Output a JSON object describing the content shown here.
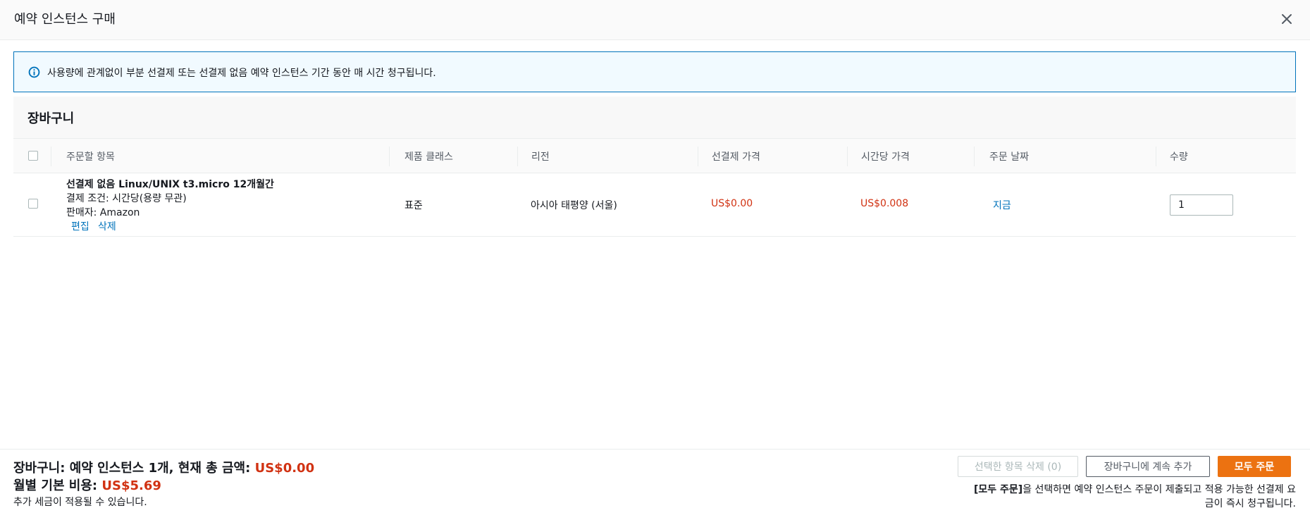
{
  "modal": {
    "title": "예약 인스턴스 구매"
  },
  "alert": {
    "text": "사용량에 관계없이 부분 선결제 또는 선결제 없음 예약 인스턴스 기간 동안 매 시간 청구됩니다."
  },
  "cart": {
    "title": "장바구니",
    "columns": [
      "주문할 항목",
      "제품 클래스",
      "리전",
      "선결제 가격",
      "시간당 가격",
      "주문 날짜",
      "수량"
    ],
    "rows": [
      {
        "title": "선결제 없음 Linux/UNIX t3.micro 12개월간",
        "payment_terms": "결제 조건: 시간당(용량 무관)",
        "seller": "판매자: Amazon",
        "edit_label": "편집",
        "delete_label": "삭제",
        "product_class": "표준",
        "region": "아시아 태평양 (서울)",
        "upfront_price": "US$0.00",
        "hourly_price": "US$0.008",
        "order_date": "지금",
        "quantity": "1"
      }
    ]
  },
  "footer": {
    "summary_label": "장바구니: 예약 인스턴스 1개, 현재 총 금액: ",
    "summary_amount": "US$0.00",
    "monthly_label": "월별 기본 비용: ",
    "monthly_amount": "US$5.69",
    "tax_note": "추가 세금이 적용될 수 있습니다.",
    "delete_selected_label": "선택한 항목 삭제 (0)",
    "continue_label": "장바구니에 계속 추가",
    "order_all_label": "모두 주문",
    "note_bold": "[모두 주문]",
    "note_text": "을 선택하면 예약 인스턴스 주문이 제출되고 적용 가능한 선결제 요금이 즉시 청구됩니다."
  },
  "colors": {
    "accent": "#0073bb",
    "price": "#d13212",
    "primary_button": "#ec7211"
  },
  "icons": {
    "close": "close-icon",
    "info": "info-icon"
  }
}
